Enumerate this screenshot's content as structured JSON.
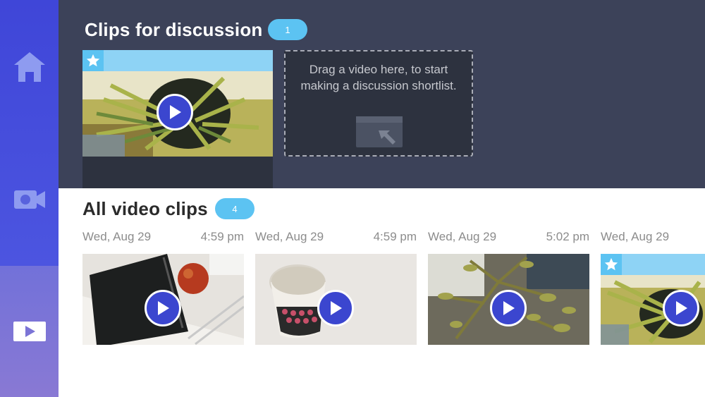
{
  "sidebar": {
    "items": [
      {
        "name": "home",
        "icon": "home-icon"
      },
      {
        "name": "record",
        "icon": "video-camera-icon"
      },
      {
        "name": "clips",
        "icon": "play-screen-icon",
        "selected": true
      }
    ]
  },
  "discussion": {
    "title": "Clips for discussion",
    "count": "1",
    "drop_text": "Drag a video here, to start making a discussion shortlist."
  },
  "all_clips": {
    "title": "All video clips",
    "count": "4",
    "clips": [
      {
        "date": "Wed, Aug 29",
        "time": "4:59 pm",
        "scene": "notebook and apple",
        "starred": false
      },
      {
        "date": "Wed, Aug 29",
        "time": "4:59 pm",
        "scene": "patterned cup",
        "starred": false
      },
      {
        "date": "Wed, Aug 29",
        "time": "5:02 pm",
        "scene": "leafy plant",
        "starred": false
      },
      {
        "date": "Wed, Aug 29",
        "time": "",
        "scene": "palm plant",
        "starred": true
      }
    ]
  },
  "colors": {
    "accent": "#5cc3f2",
    "play_button": "#3b46cf",
    "panel_dark": "#3c4259",
    "sidebar_top": "#4c55e0",
    "sidebar_selected": "#8979d4"
  }
}
